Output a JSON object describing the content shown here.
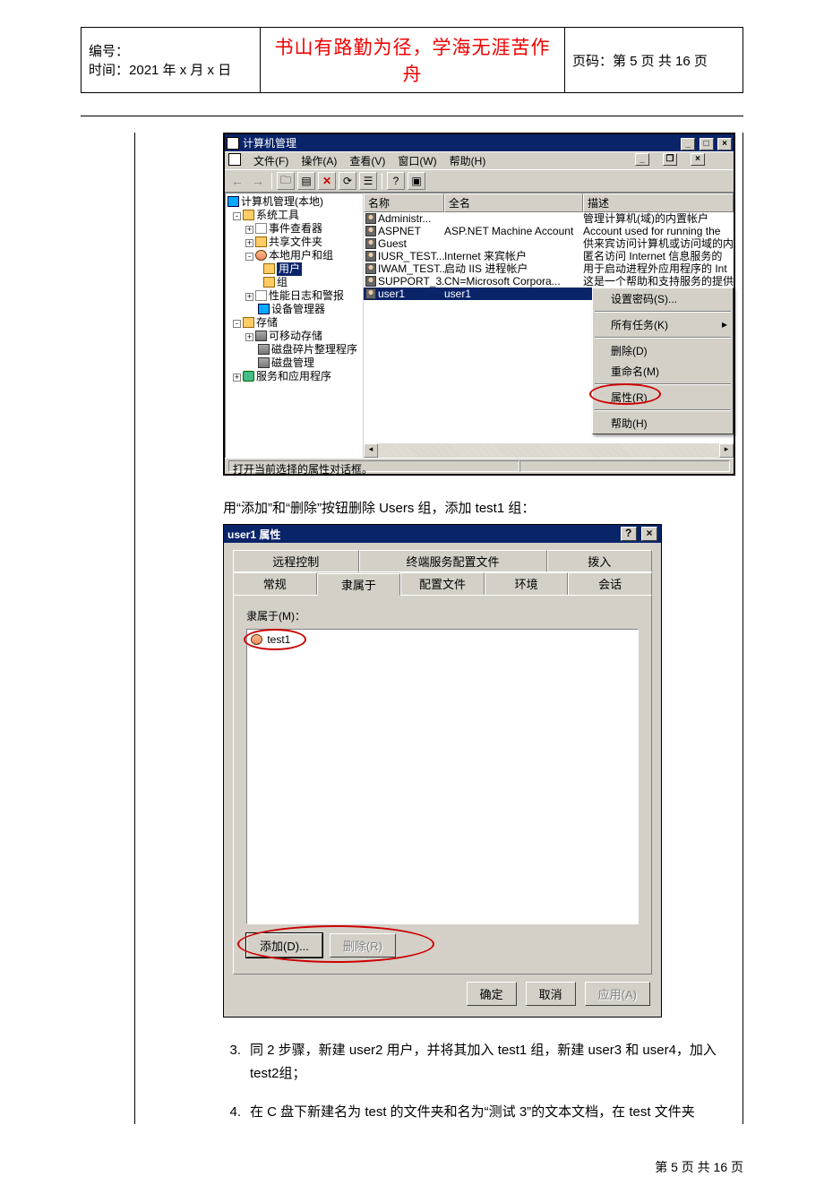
{
  "doc": {
    "header_id_label": "编号：",
    "header_time_label": "时间：",
    "header_time_value": "2021 年 x 月 x 日",
    "banner": "书山有路勤为径，学海无涯苦作舟",
    "page_label_prefix": "页码：第 ",
    "page_current": "5",
    "page_mid": " 页 共 ",
    "page_total": "16",
    "page_suffix": " 页",
    "footer": "第 5 页 共 16 页"
  },
  "win1": {
    "title": "计算机管理",
    "menu": {
      "file": "文件(F)",
      "action": "操作(A)",
      "view": "查看(V)",
      "window": "窗口(W)",
      "help": "帮助(H)"
    },
    "tree": {
      "root": "计算机管理(本地)",
      "systools": "系统工具",
      "eventviewer": "事件查看器",
      "shared": "共享文件夹",
      "localusers": "本地用户和组",
      "users": "用户",
      "groups": "组",
      "perf": "性能日志和警报",
      "devmgr": "设备管理器",
      "storage": "存储",
      "removable": "可移动存储",
      "defrag": "磁盘碎片整理程序",
      "diskmgmt": "磁盘管理",
      "services": "服务和应用程序"
    },
    "cols": {
      "name": "名称",
      "full": "全名",
      "desc": "描述"
    },
    "rows": [
      {
        "n": "Administr...",
        "f": "",
        "d": "管理计算机(域)的内置帐户"
      },
      {
        "n": "ASPNET",
        "f": "ASP.NET Machine Account",
        "d": "Account used for running the"
      },
      {
        "n": "Guest",
        "f": "",
        "d": "供来宾访问计算机或访问域的内"
      },
      {
        "n": "IUSR_TEST...",
        "f": "Internet 来宾帐户",
        "d": "匿名访问 Internet 信息服务的"
      },
      {
        "n": "IWAM_TEST...",
        "f": "启动 IIS 进程帐户",
        "d": "用于启动进程外应用程序的 Int"
      },
      {
        "n": "SUPPORT_3...",
        "f": "CN=Microsoft Corpora...",
        "d": "这是一个帮助和支持服务的提供"
      },
      {
        "n": "user1",
        "f": "user1",
        "d": ""
      }
    ],
    "context": {
      "setpwd": "设置密码(S)...",
      "alltasks": "所有任务(K)",
      "delete": "删除(D)",
      "rename": "重命名(M)",
      "props": "属性(R)",
      "help": "帮助(H)"
    },
    "status": "打开当前选择的属性对话框。"
  },
  "instruction": "用“添加”和“删除”按钮删除 Users 组，添加 test1 组：",
  "win2": {
    "title": "user1 属性",
    "tabs_top": {
      "remote": "远程控制",
      "terminal": "终端服务配置文件",
      "dialin": "拨入"
    },
    "tabs_bot": {
      "general": "常规",
      "memberof": "隶属于",
      "profile": "配置文件",
      "env": "环境",
      "session": "会话"
    },
    "memberof_label": "隶属于(M)：",
    "group": "test1",
    "add": "添加(D)...",
    "remove": "删除(R)",
    "ok": "确定",
    "cancel": "取消",
    "apply": "应用(A)"
  },
  "steps": {
    "s3_num": "3.",
    "s3_text": "同 2 步骤，新建 user2 用户，并将其加入 test1 组，新建 user3 和 user4，加入 test2组；",
    "s4_num": "4.",
    "s4_text": "在 C 盘下新建名为 test 的文件夹和名为“测试 3”的文本文档，在 test 文件夹"
  }
}
